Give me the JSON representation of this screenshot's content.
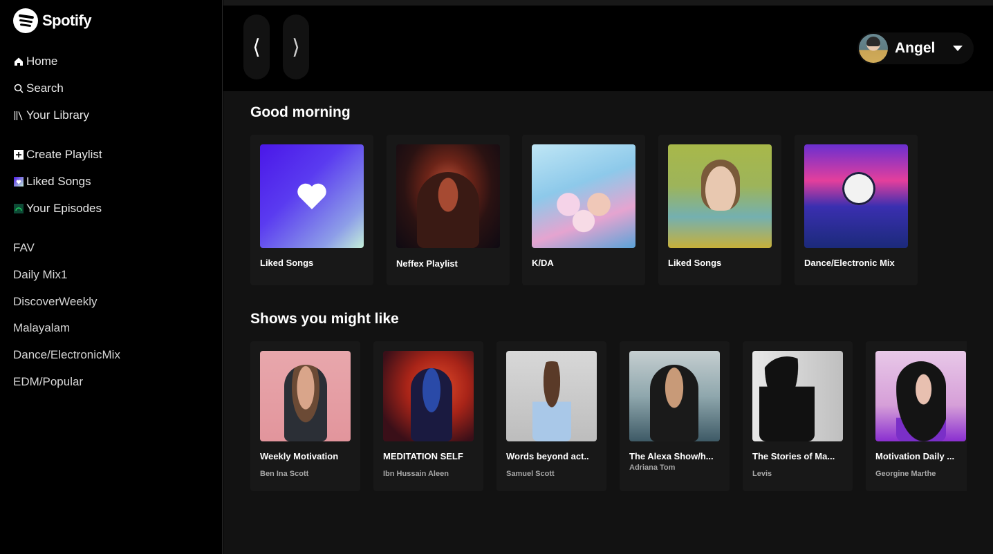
{
  "brand": {
    "name": "Spotify"
  },
  "sidebar": {
    "primary": [
      {
        "label": "Home",
        "icon": "home-icon"
      },
      {
        "label": "Search",
        "icon": "search-icon"
      },
      {
        "label": "Your Library",
        "icon": "library-icon"
      }
    ],
    "actions": [
      {
        "label": "Create Playlist",
        "icon": "plus-square-icon"
      },
      {
        "label": "Liked Songs",
        "icon": "liked-songs-icon"
      },
      {
        "label": "Your Episodes",
        "icon": "episodes-icon"
      }
    ],
    "playlists": [
      "FAV",
      "Daily Mix1",
      "DiscoverWeekly",
      "Malayalam",
      "Dance/ElectronicMix",
      "EDM/Popular"
    ]
  },
  "topbar": {
    "back_glyph": "⟨",
    "forward_glyph": "⟩",
    "user_name": "Angel"
  },
  "main": {
    "greeting": "Good morning",
    "playlists": [
      {
        "title": "Liked Songs"
      },
      {
        "title": "Neffex Playlist"
      },
      {
        "title": "K/DA"
      },
      {
        "title": "Liked Songs"
      },
      {
        "title": "Dance/Electronic Mix"
      }
    ],
    "shows_title": "Shows you might like",
    "shows": [
      {
        "title": "Weekly Motivation",
        "author": "Ben Ina Scott"
      },
      {
        "title": "MEDITATION SELF",
        "author": "Ibn Hussain Aleen"
      },
      {
        "title": "Words beyond act..",
        "author": "Samuel Scott"
      },
      {
        "title": "The Alexa Show/h...",
        "author": "Adriana Tom"
      },
      {
        "title": "The Stories of Ma...",
        "author": "Levis"
      },
      {
        "title": "Motivation Daily ...",
        "author": "Georgine Marthe"
      }
    ]
  },
  "colors": {
    "background": "#121212",
    "sidebar": "#000000",
    "card": "#181818",
    "subtext": "#a7a7a7"
  }
}
